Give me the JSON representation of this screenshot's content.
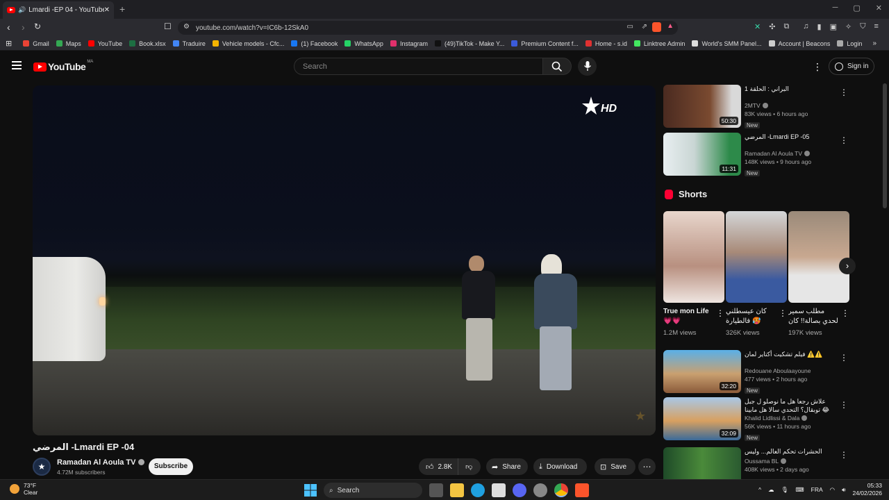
{
  "browser": {
    "tab_title": "Lmardi -EP 04 - YouTube- المرضي",
    "new_tab_icon": "+",
    "url": "youtube.com/watch?v=IC6b-12SkA0",
    "bookmarks": [
      {
        "label": "Gmail",
        "color": "#ea4335"
      },
      {
        "label": "Maps",
        "color": "#34a853"
      },
      {
        "label": "YouTube",
        "color": "#ff0000"
      },
      {
        "label": "Book.xlsx",
        "color": "#1d6f42"
      },
      {
        "label": "Traduire",
        "color": "#4285f4"
      },
      {
        "label": "Vehicle models - Cfc...",
        "color": "#f4b400"
      },
      {
        "label": "(1) Facebook",
        "color": "#1877f2"
      },
      {
        "label": "WhatsApp",
        "color": "#25d366"
      },
      {
        "label": "Instagram",
        "color": "#e1306c"
      },
      {
        "label": "(49)TikTok - Make Y...",
        "color": "#111111"
      },
      {
        "label": "Premium Content f...",
        "color": "#3b5bdb"
      },
      {
        "label": "Home - s.id",
        "color": "#e03131"
      },
      {
        "label": "Linktree Admin",
        "color": "#43e660"
      },
      {
        "label": "World's SMM Panel...",
        "color": "#dddddd"
      },
      {
        "label": "Account | Beacons",
        "color": "#cccccc"
      },
      {
        "label": "Login",
        "color": "#aaaaaa"
      }
    ]
  },
  "header": {
    "logo_text": "YouTube",
    "country_code": "MA",
    "search_placeholder": "Search",
    "signin_label": "Sign in"
  },
  "video": {
    "title": "المرضي -Lmardi EP -04",
    "channel": "Ramadan Al Aoula TV",
    "subscribers": "4.72M subscribers",
    "subscribe_label": "Subscribe",
    "likes": "2.8K",
    "share_label": "Share",
    "download_label": "Download",
    "save_label": "Save",
    "overlay_logo": "HD"
  },
  "recommendations_top": [
    {
      "title": "البراني : الحلقة 1",
      "channel": "2MTV",
      "meta": "83K views • 6 hours ago",
      "badge": "New",
      "duration": "50:30",
      "color": "#6b3a2a"
    },
    {
      "title": "المرضي -Lmardi EP -05",
      "channel": "Ramadan Al Aoula TV",
      "meta": "148K views • 9 hours ago",
      "badge": "New",
      "duration": "11:31",
      "color": "#2d8a4a"
    }
  ],
  "shorts": {
    "heading": "Shorts",
    "items": [
      {
        "title": "True mon Life 💗💗",
        "views": "1.2M views",
        "color": "#c9a89a"
      },
      {
        "title": "كان عيسطلني فالطيارة 🥵",
        "views": "326K views",
        "color": "#9fb6cf"
      },
      {
        "title": "مطلب سمير لحدي بصالة!! كان عدي",
        "views": "197K views",
        "color": "#b7a08e"
      }
    ]
  },
  "recommendations_bottom": [
    {
      "title": "فيلم تشكيت أكتاير لمان ⚠️⚠️",
      "channel": "Redouane Aboulaayoune",
      "meta": "477 views • 2 hours ago",
      "badge": "New",
      "duration": "32:20",
      "color": "#3a6fa8"
    },
    {
      "title": "علاش رجعا هل ما نوصلو ل جبل توبقال؟ التحدي سالا هل مابينا 😂",
      "channel": "Khalid Lidlissi & Dala",
      "meta": "56K views • 11 hours ago",
      "badge": "New",
      "duration": "32:09",
      "color": "#8ab3d6"
    },
    {
      "title": "الحشرات تحكم العالم... وليس البشر !",
      "channel": "Oussama BL",
      "meta": "408K views • 2 days ago",
      "badge": "",
      "duration": "",
      "color": "#2f6a3a"
    }
  ],
  "taskbar": {
    "temp": "73°F",
    "weather": "Clear",
    "search_label": "Search",
    "lang": "FRA",
    "time": "05:33",
    "date": "24/02/2026",
    "icon_colors": [
      "#0078d4",
      "#f4c542",
      "#1fa0e0",
      "#4a90d9",
      "#5865f2",
      "#dddddd",
      "#4285f4",
      "#fb542b"
    ]
  }
}
